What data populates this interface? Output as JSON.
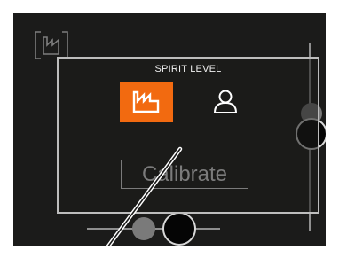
{
  "app": {
    "dialog_title": "SPIRIT LEVEL",
    "calibrate_label": "Calibrate"
  },
  "modes": [
    {
      "icon": "factory-icon",
      "selected": true
    },
    {
      "icon": "user-icon",
      "selected": false
    }
  ],
  "colors": {
    "background": "#1b1b1a",
    "accent": "#f26a10",
    "dialog_border": "#bdbdbd",
    "disabled_text": "#7b7b7b"
  }
}
